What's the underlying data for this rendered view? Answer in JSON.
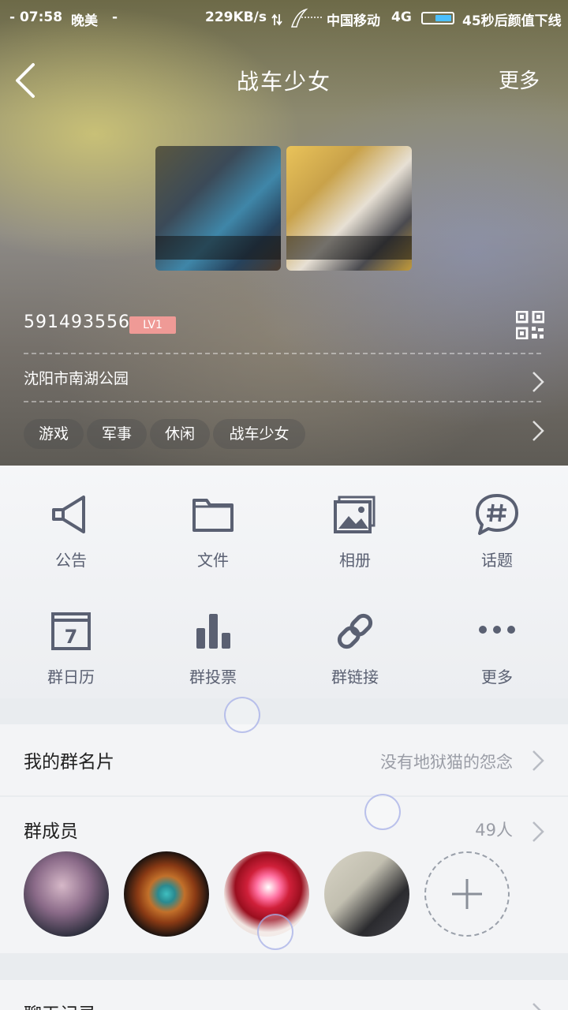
{
  "status_bar": {
    "time": "- 07:58",
    "carrier_note": "晚美",
    "dash": "-",
    "speed": "229KB/s",
    "network": "中国移动",
    "signal_type": "4G",
    "notice": "45秒后颜值下线",
    "battery_color": "#4cc0ff"
  },
  "nav": {
    "title": "战车少女",
    "more_label": "更多"
  },
  "group": {
    "id": "591493556",
    "level": "LV1",
    "location": "沈阳市南湖公园",
    "tags": [
      "游戏",
      "军事",
      "休闲",
      "战车少女"
    ]
  },
  "features": [
    {
      "label": "公告",
      "icon": "megaphone-icon"
    },
    {
      "label": "文件",
      "icon": "folder-icon"
    },
    {
      "label": "相册",
      "icon": "photo-album-icon"
    },
    {
      "label": "话题",
      "icon": "hashtag-bubble-icon"
    },
    {
      "label": "群日历",
      "icon": "calendar-icon",
      "calendar_day": "7"
    },
    {
      "label": "群投票",
      "icon": "bar-chart-icon"
    },
    {
      "label": "群链接",
      "icon": "link-icon"
    },
    {
      "label": "更多",
      "icon": "more-dots-icon"
    }
  ],
  "my_card": {
    "title": "我的群名片",
    "value": "没有地狱猫的怨念"
  },
  "members": {
    "title": "群成员",
    "count": "49人",
    "avatars": [
      "member-avatar-1",
      "member-avatar-2",
      "member-avatar-3",
      "member-avatar-4"
    ]
  },
  "chat_history": {
    "title": "聊天记录"
  },
  "colors": {
    "accent_icon": "#5a6072",
    "level_badge": "#ef9a96"
  }
}
